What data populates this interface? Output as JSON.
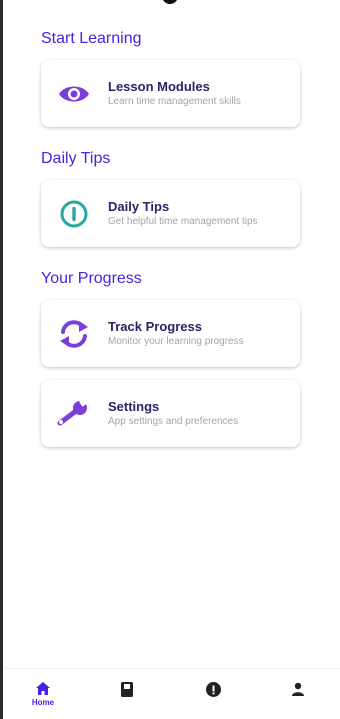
{
  "colors": {
    "accent": "#4a22e0",
    "icon_purple": "#7b3fd8",
    "icon_teal": "#2aa6a0",
    "card_title": "#2a2466",
    "card_subtitle": "#a3a3ad",
    "nav_inactive": "#222222"
  },
  "sections": [
    {
      "title": "Start Learning",
      "cards": [
        {
          "title": "Lesson Modules",
          "subtitle": "Learn time management skills",
          "icon": "eye-icon"
        }
      ]
    },
    {
      "title": "Daily Tips",
      "cards": [
        {
          "title": "Daily Tips",
          "subtitle": "Get helpful time management tips",
          "icon": "info-circle-icon"
        }
      ]
    },
    {
      "title": "Your Progress",
      "cards": [
        {
          "title": "Track Progress",
          "subtitle": "Monitor your learning progress",
          "icon": "sync-arrows-icon"
        },
        {
          "title": "Settings",
          "subtitle": "App settings and preferences",
          "icon": "wrench-icon"
        }
      ]
    }
  ],
  "bottom_nav": {
    "items": [
      {
        "label": "Home",
        "icon": "home-icon",
        "active": true
      },
      {
        "label": "",
        "icon": "book-icon",
        "active": false
      },
      {
        "label": "",
        "icon": "info-icon",
        "active": false
      },
      {
        "label": "",
        "icon": "person-icon",
        "active": false
      }
    ]
  }
}
